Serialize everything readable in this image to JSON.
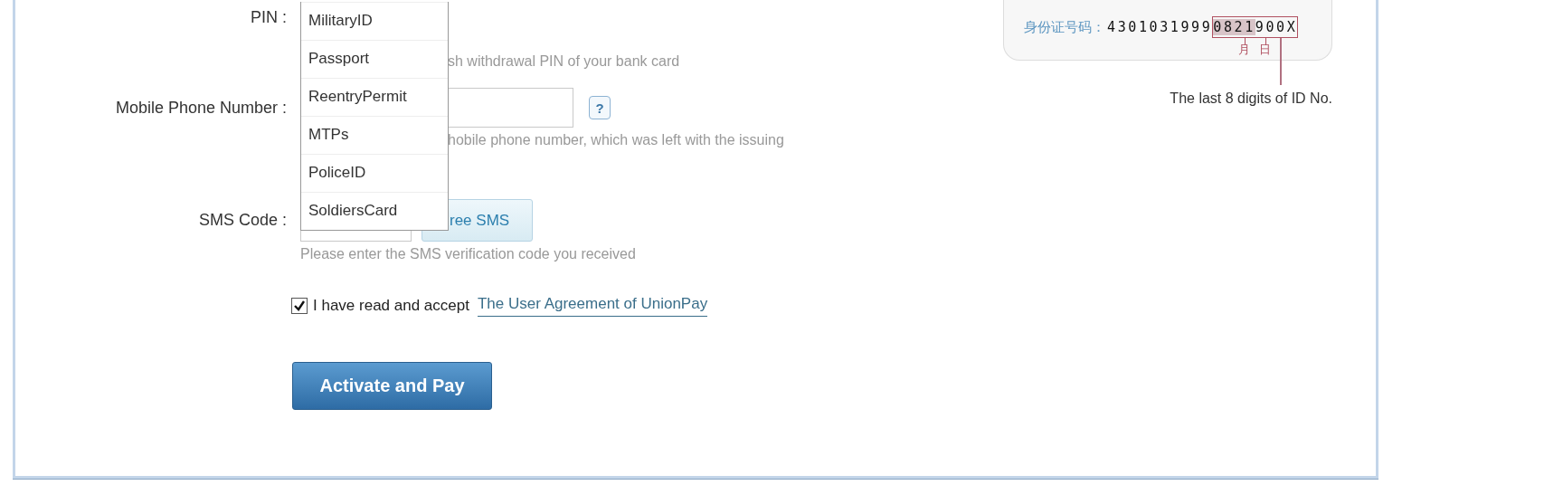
{
  "form": {
    "fields": [
      {
        "kind": "pin",
        "label": "PIN :",
        "hint": "sh withdrawal PIN of your bank card"
      },
      {
        "kind": "phone",
        "label": "Mobile Phone Number :",
        "help": "?",
        "hint": "hobile phone number, which was left with the issuing"
      },
      {
        "kind": "sms",
        "label": "SMS Code :",
        "button": "ree SMS",
        "hint": "Please enter the SMS verification code you received"
      }
    ],
    "dropdown": {
      "options": [
        "MilitaryID",
        "Passport",
        "ReentryPermit",
        "MTPs",
        "PoliceID",
        "SoldiersCard"
      ]
    },
    "agreement": {
      "checked": true,
      "text": "I have read and accept",
      "link": "The User Agreement of UnionPay"
    },
    "submit": "Activate and Pay"
  },
  "id_example": {
    "label": "身份证号码：",
    "number_prefix": "4301031999",
    "highlight_shaded": "0821",
    "highlight_rest": "900X",
    "month": "月",
    "day": "日",
    "caption": "The last 8 digits of ID No."
  }
}
